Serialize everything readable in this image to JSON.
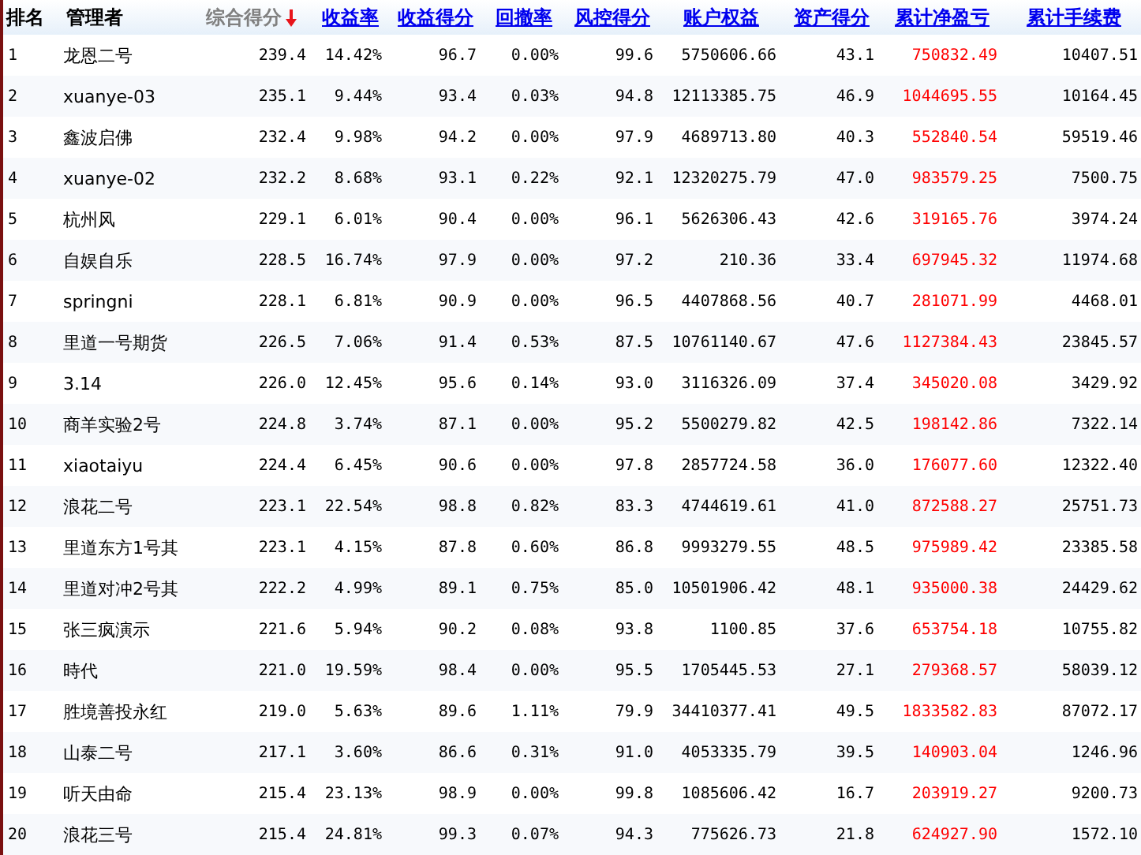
{
  "table": {
    "columns": [
      {
        "label": "排名",
        "sorted": false,
        "link": false
      },
      {
        "label": "管理者",
        "sorted": false,
        "link": false
      },
      {
        "label": "综合得分",
        "sorted": true,
        "link": false
      },
      {
        "label": "收益率",
        "sorted": false,
        "link": true
      },
      {
        "label": "收益得分",
        "sorted": false,
        "link": true
      },
      {
        "label": "回撤率",
        "sorted": false,
        "link": true
      },
      {
        "label": "风控得分",
        "sorted": false,
        "link": true
      },
      {
        "label": "账户权益",
        "sorted": false,
        "link": true
      },
      {
        "label": "资产得分",
        "sorted": false,
        "link": true
      },
      {
        "label": "累计净盈亏",
        "sorted": false,
        "link": true
      },
      {
        "label": "累计手续费",
        "sorted": false,
        "link": true
      }
    ],
    "rows": [
      [
        "1",
        "龙恩二号",
        "239.4",
        "14.42%",
        "96.7",
        "0.00%",
        "99.6",
        "5750606.66",
        "43.1",
        "750832.49",
        "10407.51"
      ],
      [
        "2",
        "xuanye-03",
        "235.1",
        "9.44%",
        "93.4",
        "0.03%",
        "94.8",
        "12113385.75",
        "46.9",
        "1044695.55",
        "10164.45"
      ],
      [
        "3",
        "鑫波启佛",
        "232.4",
        "9.98%",
        "94.2",
        "0.00%",
        "97.9",
        "4689713.80",
        "40.3",
        "552840.54",
        "59519.46"
      ],
      [
        "4",
        "xuanye-02",
        "232.2",
        "8.68%",
        "93.1",
        "0.22%",
        "92.1",
        "12320275.79",
        "47.0",
        "983579.25",
        "7500.75"
      ],
      [
        "5",
        "杭州风",
        "229.1",
        "6.01%",
        "90.4",
        "0.00%",
        "96.1",
        "5626306.43",
        "42.6",
        "319165.76",
        "3974.24"
      ],
      [
        "6",
        "自娱自乐",
        "228.5",
        "16.74%",
        "97.9",
        "0.00%",
        "97.2",
        "210.36",
        "33.4",
        "697945.32",
        "11974.68"
      ],
      [
        "7",
        "springni",
        "228.1",
        "6.81%",
        "90.9",
        "0.00%",
        "96.5",
        "4407868.56",
        "40.7",
        "281071.99",
        "4468.01"
      ],
      [
        "8",
        "里道一号期货",
        "226.5",
        "7.06%",
        "91.4",
        "0.53%",
        "87.5",
        "10761140.67",
        "47.6",
        "1127384.43",
        "23845.57"
      ],
      [
        "9",
        "3.14",
        "226.0",
        "12.45%",
        "95.6",
        "0.14%",
        "93.0",
        "3116326.09",
        "37.4",
        "345020.08",
        "3429.92"
      ],
      [
        "10",
        "商羊实验2号",
        "224.8",
        "3.74%",
        "87.1",
        "0.00%",
        "95.2",
        "5500279.82",
        "42.5",
        "198142.86",
        "7322.14"
      ],
      [
        "11",
        "xiaotaiyu",
        "224.4",
        "6.45%",
        "90.6",
        "0.00%",
        "97.8",
        "2857724.58",
        "36.0",
        "176077.60",
        "12322.40"
      ],
      [
        "12",
        "浪花二号",
        "223.1",
        "22.54%",
        "98.8",
        "0.82%",
        "83.3",
        "4744619.61",
        "41.0",
        "872588.27",
        "25751.73"
      ],
      [
        "13",
        "里道东方1号其",
        "223.1",
        "4.15%",
        "87.8",
        "0.60%",
        "86.8",
        "9993279.55",
        "48.5",
        "975989.42",
        "23385.58"
      ],
      [
        "14",
        "里道对冲2号其",
        "222.2",
        "4.99%",
        "89.1",
        "0.75%",
        "85.0",
        "10501906.42",
        "48.1",
        "935000.38",
        "24429.62"
      ],
      [
        "15",
        "张三疯演示",
        "221.6",
        "5.94%",
        "90.2",
        "0.08%",
        "93.8",
        "1100.85",
        "37.6",
        "653754.18",
        "10755.82"
      ],
      [
        "16",
        "時代",
        "221.0",
        "19.59%",
        "98.4",
        "0.00%",
        "95.5",
        "1705445.53",
        "27.1",
        "279368.57",
        "58039.12"
      ],
      [
        "17",
        "胜境善投永红",
        "219.0",
        "5.63%",
        "89.6",
        "1.11%",
        "79.9",
        "34410377.41",
        "49.5",
        "1833582.83",
        "87072.17"
      ],
      [
        "18",
        "山泰二号",
        "217.1",
        "3.60%",
        "86.6",
        "0.31%",
        "91.0",
        "4053335.79",
        "39.5",
        "140903.04",
        "1246.96"
      ],
      [
        "19",
        "听天由命",
        "215.4",
        "23.13%",
        "98.9",
        "0.00%",
        "99.8",
        "1085606.42",
        "16.7",
        "203919.27",
        "9200.73"
      ],
      [
        "20",
        "浪花三号",
        "215.4",
        "24.81%",
        "99.3",
        "0.07%",
        "94.3",
        "775626.73",
        "21.8",
        "624927.90",
        "1572.10"
      ]
    ]
  }
}
